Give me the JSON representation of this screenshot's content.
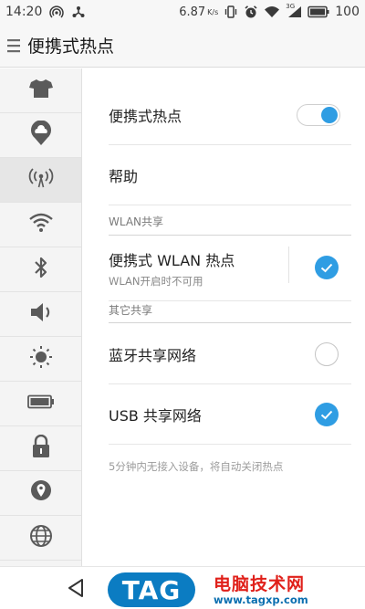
{
  "status_bar": {
    "time": "14:20",
    "net_speed": "6.87",
    "net_unit": "K/s",
    "signal_label": "3G",
    "battery": "100",
    "icons": [
      "wifi-hotspot-icon",
      "usb-share-icon",
      "vibrate-icon",
      "alarm-icon",
      "wifi-icon",
      "signal-icon",
      "battery-icon"
    ]
  },
  "app_bar": {
    "title": "便携式热点"
  },
  "side_nav": {
    "items": [
      {
        "name": "theme",
        "icon": "shirt-icon"
      },
      {
        "name": "cloud",
        "icon": "cloud-icon"
      },
      {
        "name": "hotspot",
        "icon": "hotspot-icon",
        "active": true
      },
      {
        "name": "wifi",
        "icon": "wifi-icon"
      },
      {
        "name": "bluetooth",
        "icon": "bluetooth-icon"
      },
      {
        "name": "sound",
        "icon": "speaker-icon"
      },
      {
        "name": "display",
        "icon": "brightness-icon"
      },
      {
        "name": "battery",
        "icon": "battery-icon"
      },
      {
        "name": "security",
        "icon": "lock-icon"
      },
      {
        "name": "location",
        "icon": "location-pin-icon"
      },
      {
        "name": "language",
        "icon": "globe-icon"
      }
    ]
  },
  "content": {
    "hotspot_toggle": {
      "label": "便携式热点",
      "enabled": true
    },
    "help": {
      "label": "帮助"
    },
    "wlan_section": {
      "header": "WLAN共享"
    },
    "wlan_hotspot": {
      "label": "便携式 WLAN 热点",
      "sublabel": "WLAN开启时不可用",
      "checked": true
    },
    "other_section": {
      "header": "其它共享"
    },
    "bt_share": {
      "label": "蓝牙共享网络",
      "checked": false
    },
    "usb_share": {
      "label": "USB 共享网络",
      "checked": true
    },
    "footnote": "5分钟内无接入设备，将自动关闭热点"
  },
  "bottom_bar": {
    "logo_text": "TAG",
    "brand_name": "电脑技术网",
    "brand_url": "www.tagxp.com"
  },
  "colors": {
    "accent": "#2f9de3",
    "brand_red": "#e0201a",
    "brand_blue": "#0b7cc2"
  }
}
